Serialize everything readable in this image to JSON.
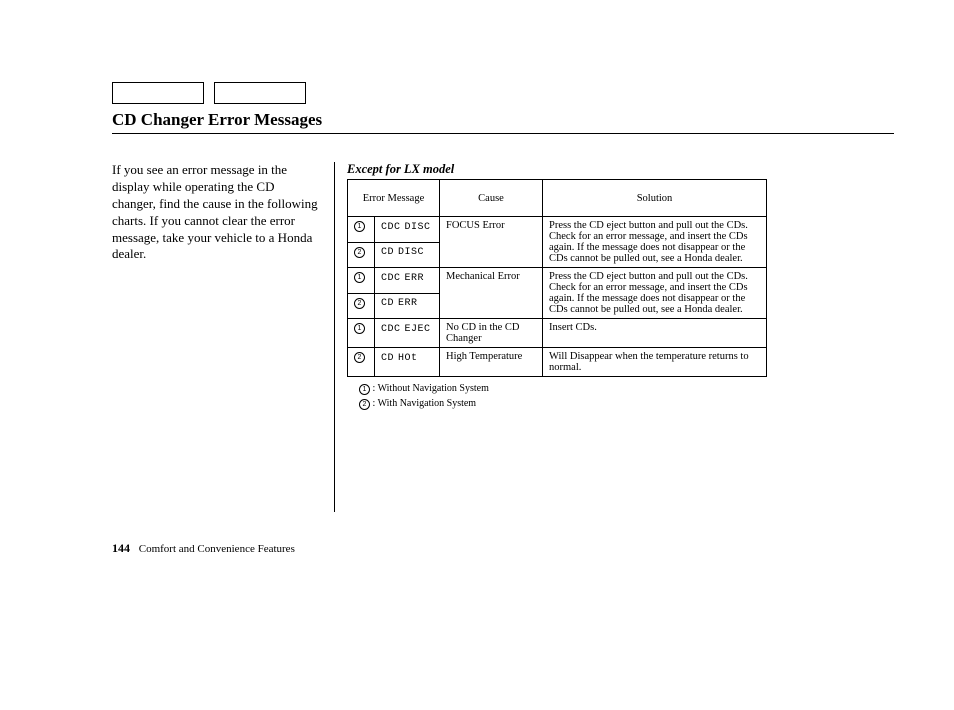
{
  "title": "CD Changer Error Messages",
  "intro": "If you see an error message in the display while operating the CD changer, find the cause in the following charts. If you cannot clear the error message, take your vehicle to a Honda dealer.",
  "table_caption": "Except for LX model",
  "headers": {
    "msg": "Error Message",
    "cause": "Cause",
    "solution": "Solution"
  },
  "rows": [
    {
      "ref": "1",
      "lcd_a": "CDC",
      "lcd_b": "DISC"
    },
    {
      "ref": "2",
      "lcd_a": "CD",
      "lcd_b": "DISC"
    },
    {
      "ref": "1",
      "lcd_a": "CDC",
      "lcd_b": "ERR"
    },
    {
      "ref": "2",
      "lcd_a": "CD",
      "lcd_b": "ERR"
    },
    {
      "ref": "1",
      "lcd_a": "CDC",
      "lcd_b": "EJEC"
    },
    {
      "ref": "2",
      "lcd_a": "CD",
      "lcd_b": "HOt"
    }
  ],
  "causes": {
    "focus": "FOCUS Error",
    "mech": "Mechanical Error",
    "nocd": "No CD in the CD Changer",
    "hitemp": "High Temperature"
  },
  "solutions": {
    "eject": "Press the CD eject button and pull out the CDs. Check for an error message, and insert the CDs again. If the message does not disappear or the CDs cannot be pulled out, see a Honda dealer.",
    "insert": "Insert CDs.",
    "temp": "Will Disappear when the temperature returns to normal."
  },
  "legend": {
    "l1_mark": "1",
    "l1_text": ": Without Navigation System",
    "l2_mark": "2",
    "l2_text": ": With Navigation System"
  },
  "footer": {
    "page": "144",
    "section": "Comfort and Convenience Features"
  }
}
